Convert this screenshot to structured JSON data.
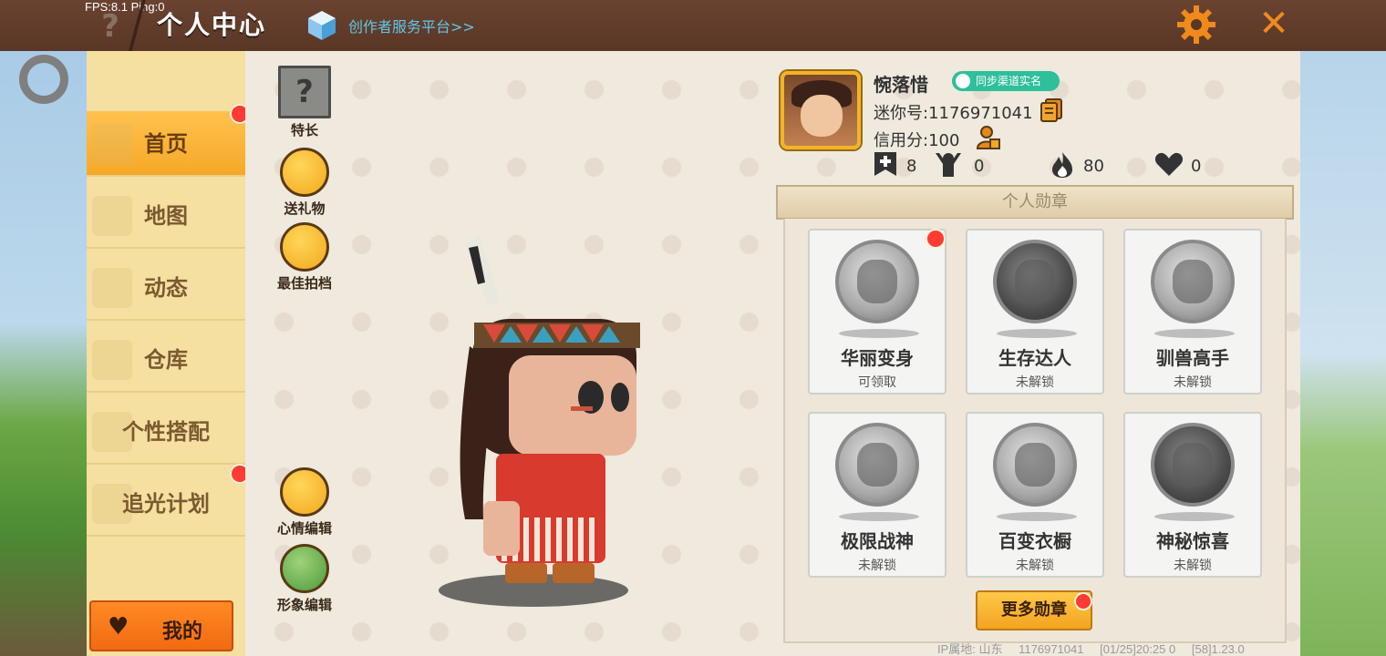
{
  "topbar": {
    "fps": "FPS:8.1  Ping:0",
    "help_glyph": "?",
    "title": "个人中心",
    "creator_link": "创作者服务平台>>",
    "close_glyph": "✕"
  },
  "nav": {
    "items": [
      {
        "label": "首页",
        "active": true,
        "dot": true
      },
      {
        "label": "地图",
        "active": false,
        "dot": false
      },
      {
        "label": "动态",
        "active": false,
        "dot": false
      },
      {
        "label": "仓库",
        "active": false,
        "dot": false
      },
      {
        "label": "个性搭配",
        "active": false,
        "dot": false
      },
      {
        "label": "追光计划",
        "active": false,
        "dot": true
      }
    ],
    "mine_label": "我的"
  },
  "skills": {
    "specialty": "特长",
    "gift": "送礼物",
    "partner": "最佳拍档",
    "mood_edit": "心情编辑",
    "avatar_edit": "形象编辑"
  },
  "profile": {
    "name": "惋落惜",
    "sync_label": "同步渠道实名",
    "mini_id": "迷你号:1176971041",
    "credit": "信用分:100",
    "stats": {
      "friends": "8",
      "fans": "0",
      "popularity": "80",
      "likes": "0"
    }
  },
  "medals": {
    "title": "个人勋章",
    "items": [
      {
        "name": "华丽变身",
        "status": "可领取",
        "dot": true
      },
      {
        "name": "生存达人",
        "status": "未解锁",
        "dot": false
      },
      {
        "name": "驯兽高手",
        "status": "未解锁",
        "dot": false
      },
      {
        "name": "极限战神",
        "status": "未解锁",
        "dot": false
      },
      {
        "name": "百变衣橱",
        "status": "未解锁",
        "dot": false
      },
      {
        "name": "神秘惊喜",
        "status": "未解锁",
        "dot": false
      }
    ],
    "more_label": "更多勋章"
  },
  "footer": {
    "ip": "IP属地: 山东",
    "uid": "1176971041",
    "time": "[01/25]20:25 0",
    "ver": "[58]1.23.0"
  },
  "colors": {
    "accent": "#f6a827",
    "topbar": "#5a3626",
    "nav_bg": "#f5dfa1",
    "dot": "#ff3b33",
    "sync": "#2fbf9a"
  }
}
